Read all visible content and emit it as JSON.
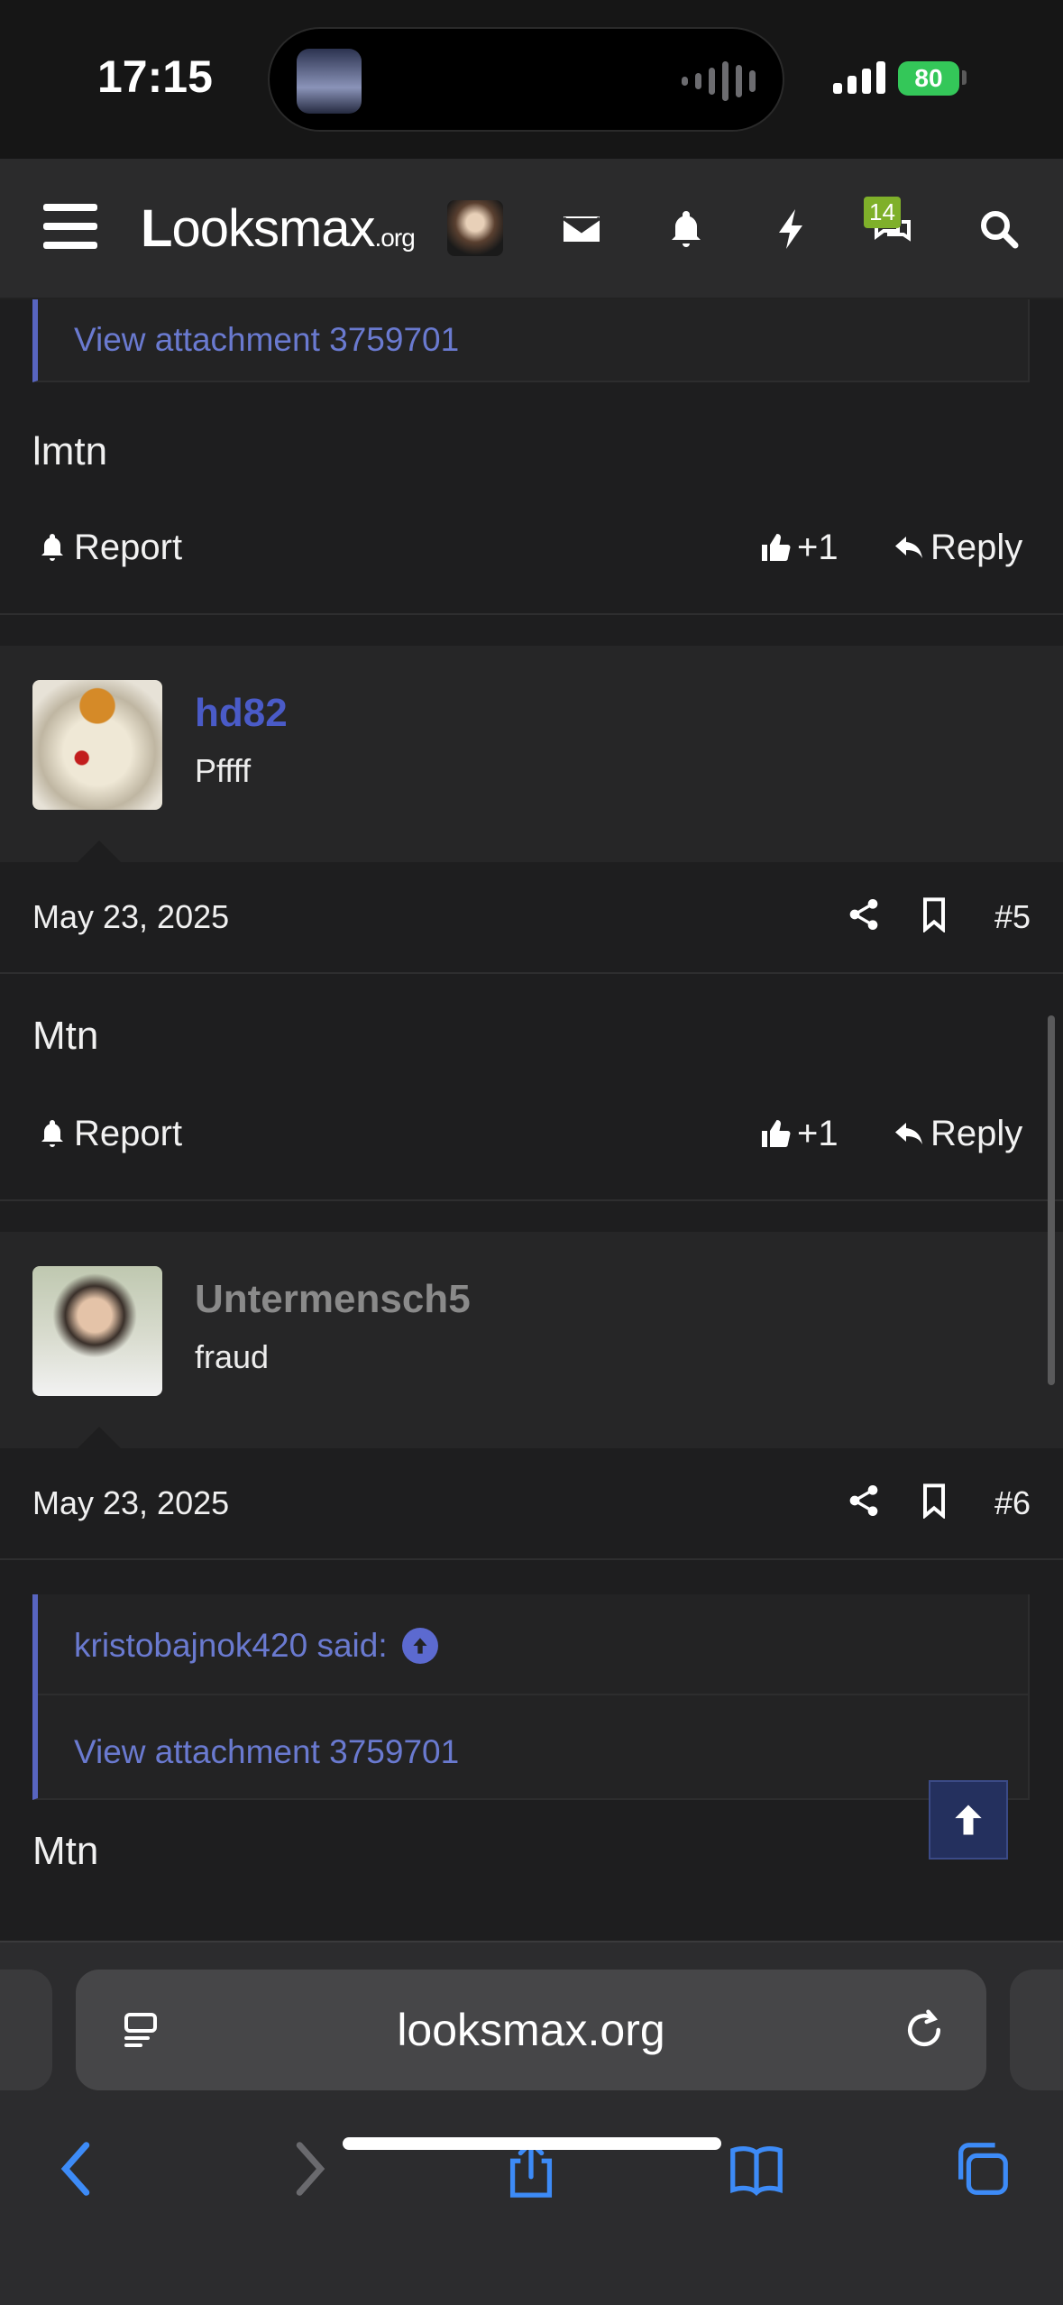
{
  "status": {
    "time": "17:15",
    "battery": "80"
  },
  "header": {
    "logo_a": "L",
    "logo_b": "ooks",
    "logo_c": "max",
    "logo_d": ".org",
    "conversations_badge": "14"
  },
  "posts": [
    {
      "quote_link": "View attachment 3759701",
      "text": "lmtn",
      "report": "Report",
      "likes": "+1",
      "reply": "Reply"
    },
    {
      "username": "hd82",
      "user_title": "Pffff",
      "date": "May 23, 2025",
      "number": "#5",
      "text": "Mtn",
      "report": "Report",
      "likes": "+1",
      "reply": "Reply"
    },
    {
      "username": "Untermensch5",
      "user_title": "fraud",
      "date": "May 23, 2025",
      "number": "#6",
      "quote_author": "kristobajnok420 said:",
      "quote_link": "View attachment 3759701",
      "text": "Mtn"
    }
  ],
  "browser": {
    "url": "looksmax.org"
  },
  "colors": {
    "accent": "#5865c0",
    "link": "#6a7ad0",
    "username_blue": "#4a5bc8",
    "username_gray": "#8a8a8a"
  }
}
